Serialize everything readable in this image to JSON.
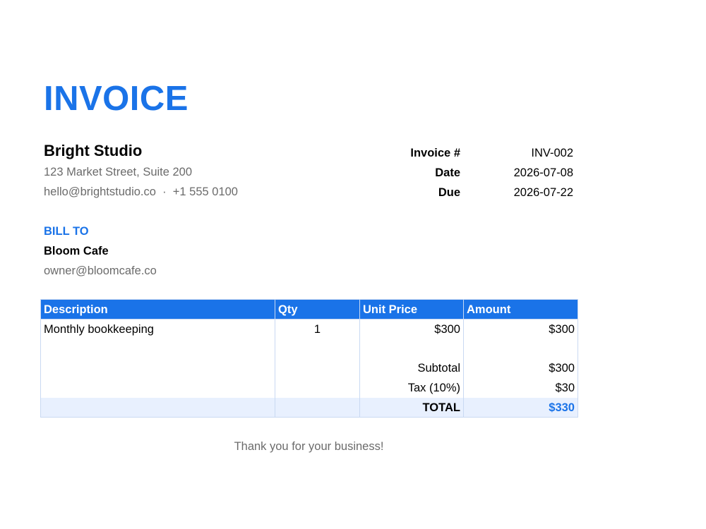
{
  "colors": {
    "accent": "#1a73e8",
    "muted_text": "#6b6b6b",
    "total_row_bg": "#e8f0fe",
    "table_border": "#c9d9f2"
  },
  "title": "INVOICE",
  "company": {
    "name": "Bright Studio",
    "address": "123 Market Street, Suite 200",
    "contact": "hello@brightstudio.co  ·  +1 555 0100"
  },
  "meta": {
    "invoice_number_label": "Invoice #",
    "invoice_number": "INV-002",
    "date_label": "Date",
    "date": "2026-07-08",
    "due_label": "Due",
    "due": "2026-07-22"
  },
  "bill_to": {
    "heading": "BILL TO",
    "name": "Bloom Cafe",
    "email": "owner@bloomcafe.co"
  },
  "table": {
    "headers": [
      "Description",
      "Qty",
      "Unit Price",
      "Amount"
    ],
    "rows": [
      {
        "description": "Monthly bookkeeping",
        "qty": "1",
        "unit_price": "$300",
        "amount": "$300"
      }
    ]
  },
  "totals": {
    "subtotal_label": "Subtotal",
    "subtotal": "$300",
    "tax_label": "Tax (10%)",
    "tax": "$30",
    "total_label": "TOTAL",
    "total": "$330"
  },
  "footer": {
    "thanks": "Thank you for your business!"
  }
}
